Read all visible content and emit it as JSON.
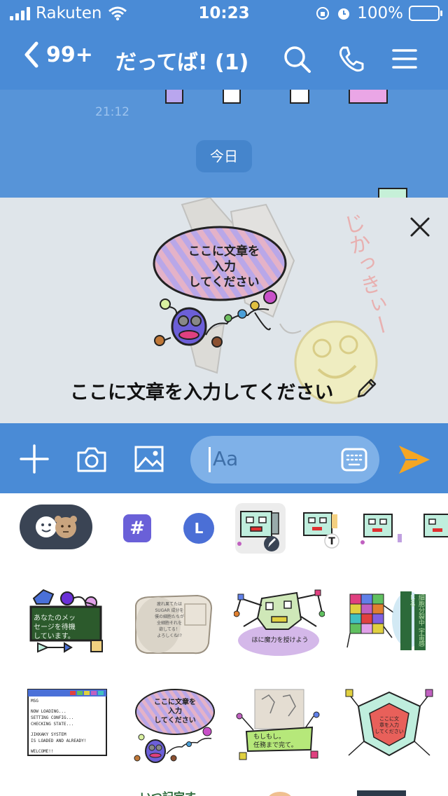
{
  "status": {
    "carrier": "Rakuten",
    "time": "10:23",
    "battery": "100%"
  },
  "header": {
    "back_count": "99+",
    "title": "だってば! (1)"
  },
  "chat": {
    "timestamp": "21:12",
    "date_label": "今日"
  },
  "preview": {
    "bubble_text_lines": [
      "ここに文章を",
      "入力",
      "してください"
    ],
    "side_text": "じかっきぃー",
    "caption": "ここに文章を入力してください"
  },
  "input": {
    "placeholder": "Aa"
  },
  "tabs": {
    "hash": "#",
    "line": "L",
    "text_badge": "T"
  },
  "stickers": {
    "s1_lines": [
      "あなたのメッ",
      "セージを待機",
      "しています。"
    ],
    "s2_lines": [
      "疲れ果てたは",
      "SUGAR 成分を",
      "僕の細胞たちが",
      "全細胞それを",
      "欲してる！",
      "よろしくね!?"
    ],
    "s3_text": "ほに魔力を授けよう",
    "s4_text": "細胞分裂中 宇宙感じる",
    "s5_lines": [
      "MSG",
      "NOW LOADING...",
      "SETTING CONFIG...",
      "CHECKING STATE...",
      "JIKKAKY SYSTEM",
      "IS LOADED AND ALREADY!",
      "WELCOME!!"
    ],
    "s6_lines": [
      "ここに文章を",
      "入力",
      "してください"
    ],
    "s7_lines": [
      "もしもし。",
      "任務まで完て。"
    ],
    "s8_lines": [
      "ここに文",
      "章を入力",
      "してください"
    ],
    "s9_partial": "いつ記定す"
  },
  "colors": {
    "header_blue": "#4a8bd6",
    "send_orange": "#f5a623",
    "tab_dark": "#3a4454",
    "hash_purple": "#6a60d8"
  }
}
